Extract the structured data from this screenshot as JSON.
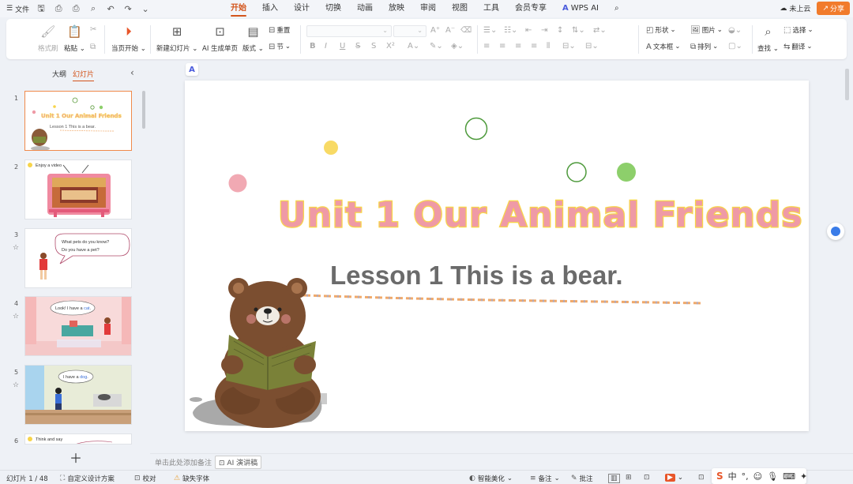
{
  "menubar": {
    "file_label": "文件",
    "tabs": [
      {
        "label": "开始",
        "active": true
      },
      {
        "label": "插入"
      },
      {
        "label": "设计"
      },
      {
        "label": "切换"
      },
      {
        "label": "动画"
      },
      {
        "label": "放映"
      },
      {
        "label": "审阅"
      },
      {
        "label": "视图"
      },
      {
        "label": "工具"
      },
      {
        "label": "会员专享"
      },
      {
        "label": "WPS AI"
      }
    ],
    "cloud_label": "未上云",
    "share_label": "分享"
  },
  "ribbon": {
    "format_painter": "格式刷",
    "paste": "粘贴",
    "start_from_current": "当页开始",
    "new_slide": "新建幻灯片",
    "ai_single": "AI 生成单页",
    "layout": "版式",
    "reset": "重置",
    "section": "节",
    "shape": "形状",
    "picture": "图片",
    "textbox": "文本框",
    "arrange": "排列",
    "find": "查找",
    "select": "选择",
    "translate": "翻译"
  },
  "sidebar": {
    "tab_outline": "大纲",
    "tab_slides": "幻灯片",
    "slides": [
      {
        "num": "1",
        "title": "Unit 1  Our Animal Friends",
        "sub": "Lesson 1  This is a bear."
      },
      {
        "num": "2",
        "caption": "Enjoy a video"
      },
      {
        "num": "3",
        "bubble1": "What pets do you know?",
        "bubble2": "Do you have a pet?"
      },
      {
        "num": "4",
        "bubble_a": "Look! I have a ",
        "bubble_b": "cat",
        "bubble_c": "."
      },
      {
        "num": "5",
        "bubble_a": "I have a ",
        "bubble_b": "dog",
        "bubble_c": "."
      },
      {
        "num": "6",
        "caption": "Think and say"
      }
    ]
  },
  "slide": {
    "title": "Unit 1  Our Animal Friends",
    "subtitle": "Lesson 1  This is a bear."
  },
  "notes": {
    "placeholder": "单击此处添加备注",
    "ai_script": "AI 演讲稿"
  },
  "statusbar": {
    "slide_count": "幻灯片 1 / 48",
    "custom_design": "自定义设计方案",
    "proofread": "校对",
    "missing_font": "缺失字体",
    "smart_beautify": "智能美化",
    "notes": "备注",
    "comments": "批注"
  },
  "ime": {
    "brand": "S",
    "lang": "中"
  },
  "colors": {
    "accent": "#d3541b",
    "share": "#f17b2c",
    "title_fill": "#ef9aa6",
    "title_outline": "#f7d44a"
  }
}
